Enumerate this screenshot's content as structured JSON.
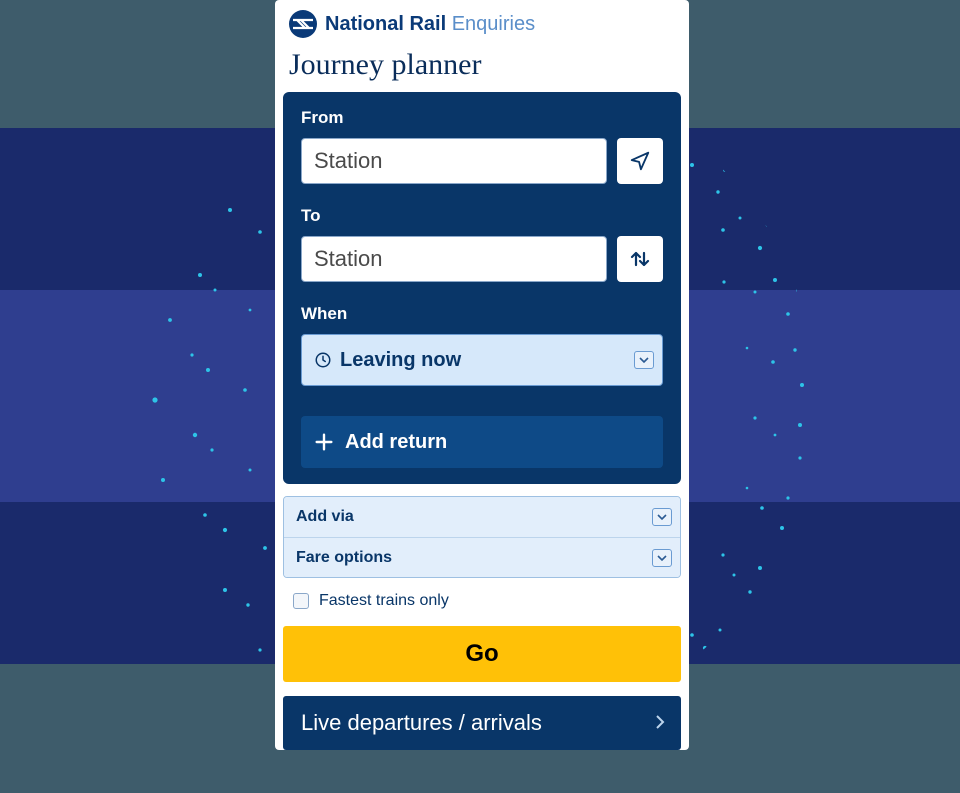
{
  "brand": {
    "strong": "National Rail",
    "light": "Enquiries"
  },
  "title": "Journey planner",
  "form": {
    "from_label": "From",
    "from_placeholder": "Station",
    "to_label": "To",
    "to_placeholder": "Station",
    "when_label": "When",
    "when_value": "Leaving now",
    "add_return": "Add return"
  },
  "options": {
    "add_via": "Add via",
    "fare_options": "Fare options",
    "fastest_only": "Fastest trains only"
  },
  "go_label": "Go",
  "live_label": "Live departures / arrivals"
}
